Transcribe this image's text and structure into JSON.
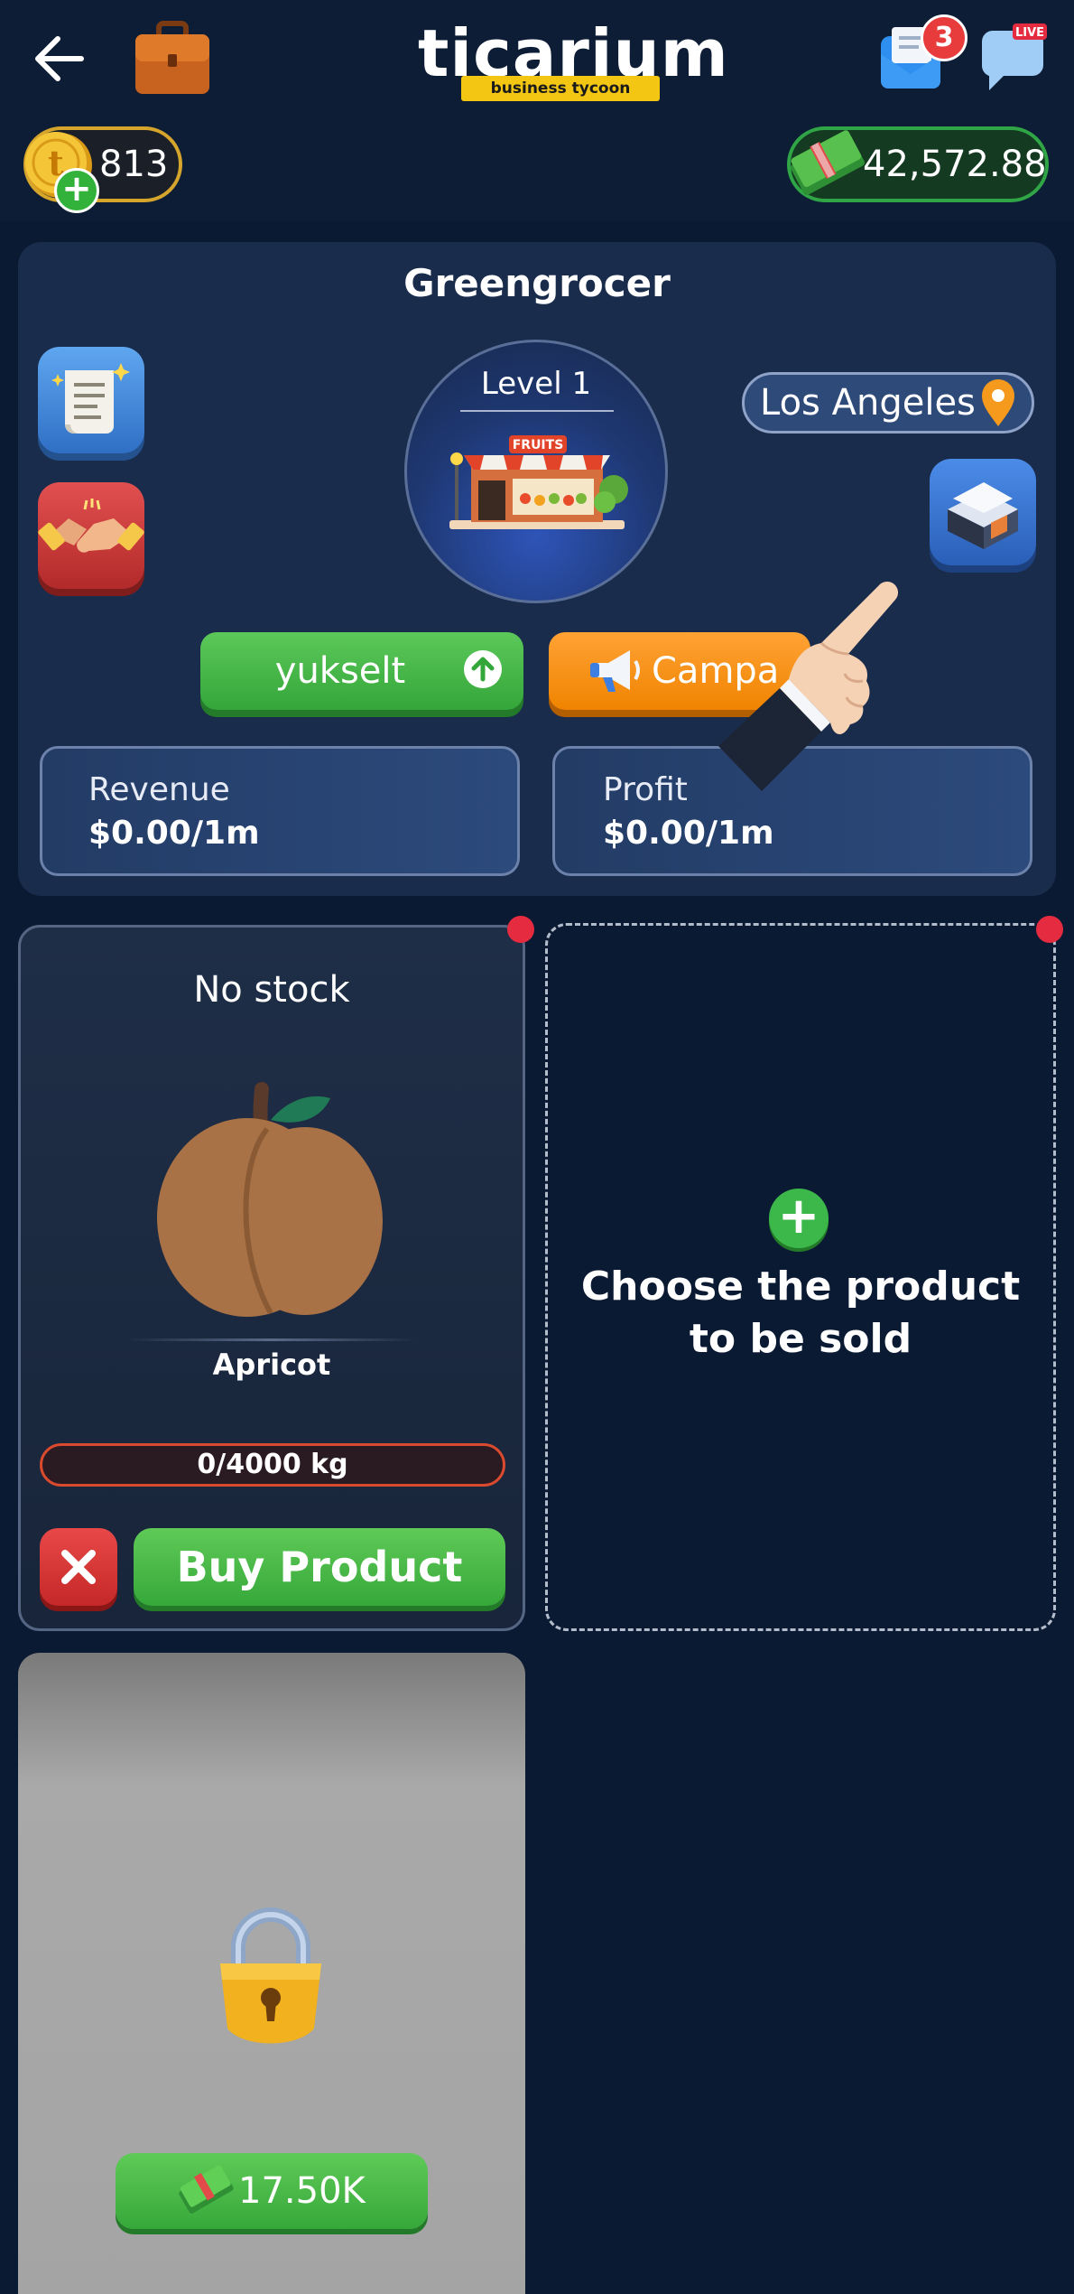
{
  "header": {
    "logo_word": "ticarium",
    "logo_tag": "business tycoon",
    "mail_badge": "3",
    "live_label": "LIVE"
  },
  "currency": {
    "coins": "813",
    "cash": "42,572.88"
  },
  "shop": {
    "title": "Greengrocer",
    "level": "Level 1",
    "location": "Los Angeles",
    "upgrade_label": "yukselt",
    "campaign_label": "Campa",
    "revenue_label": "Revenue",
    "revenue_value": "$0.00/1m",
    "profit_label": "Profit",
    "profit_value": "$0.00/1m",
    "sign_text": "FRUITS"
  },
  "product": {
    "stock_status": "No stock",
    "name": "Apricot",
    "quantity": "0/4000 kg",
    "quantity_fraction": 0,
    "buy_label": "Buy Product"
  },
  "empty_slot": {
    "label": "Choose the product\nto be sold"
  },
  "locked_slot": {
    "price": "17.50K"
  },
  "colors": {
    "background": "#0b1a33",
    "green": "#36a83a",
    "orange": "#f08400",
    "red": "#e52b3f",
    "gold": "#f3c614"
  }
}
